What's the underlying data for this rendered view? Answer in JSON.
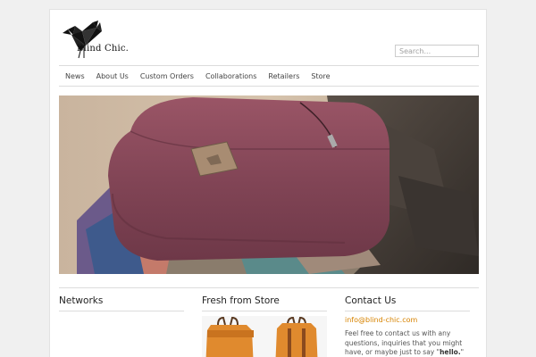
{
  "header": {
    "brand": "Blind Chic.",
    "search_placeholder": "Search..."
  },
  "nav": {
    "items": [
      "News",
      "About Us",
      "Custom Orders",
      "Collaborations",
      "Retailers",
      "Store"
    ]
  },
  "widgets": {
    "networks_title": "Networks",
    "store_title": "Fresh from Store",
    "contact_title": "Contact Us",
    "contact_email": "info@blind-chic.com",
    "contact_text": "Feel free to contact us with any questions, inquiries that you might have, or maybe just to say \"",
    "contact_hello": "hello.",
    "contact_end": "\""
  },
  "colors": {
    "accent": "#d78300",
    "bag": "#8a4a5a",
    "product": "#e08a2e"
  }
}
